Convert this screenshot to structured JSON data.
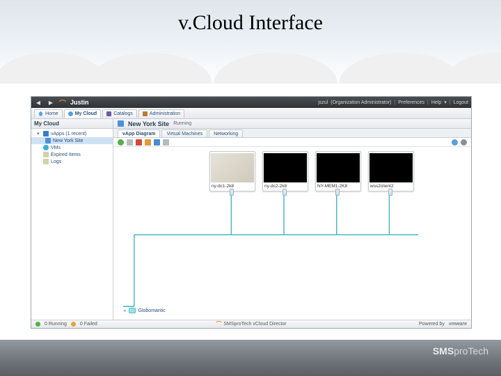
{
  "slide": {
    "title": "v.Cloud Interface"
  },
  "topbar": {
    "brand": "Justin",
    "user": "jszul",
    "role": "(Organization Administrator)",
    "preferences": "Preferences",
    "help": "Help",
    "logout": "Logout"
  },
  "tabs": [
    {
      "label": "Home"
    },
    {
      "label": "My Cloud"
    },
    {
      "label": "Catalogs"
    },
    {
      "label": "Administration"
    }
  ],
  "sidebar": {
    "title": "My Cloud",
    "items": [
      {
        "label": "vApps (1 recent)"
      },
      {
        "label": "New York Site"
      },
      {
        "label": "VMs"
      },
      {
        "label": "Expired Items"
      },
      {
        "label": "Logs"
      }
    ]
  },
  "main": {
    "title": "New York Site",
    "status": "Running",
    "subtabs": [
      {
        "label": "vApp Diagram"
      },
      {
        "label": "Virtual Machines"
      },
      {
        "label": "Networking"
      }
    ],
    "vms": [
      {
        "label": "ny-dc1-2k8"
      },
      {
        "label": "ny-dc2-2k8"
      },
      {
        "label": "NY-MEM1-2K8"
      },
      {
        "label": "wss2client2"
      }
    ],
    "network": {
      "label": "Globomantic"
    }
  },
  "footer": {
    "running_count": "0 Running",
    "failed_count": "0 Failed",
    "product": "SMSproTech vCloud Director",
    "powered": "Powered by",
    "vmware": "vmware"
  },
  "page_footer": {
    "brand_a": "SMS",
    "brand_b": "proTech"
  }
}
